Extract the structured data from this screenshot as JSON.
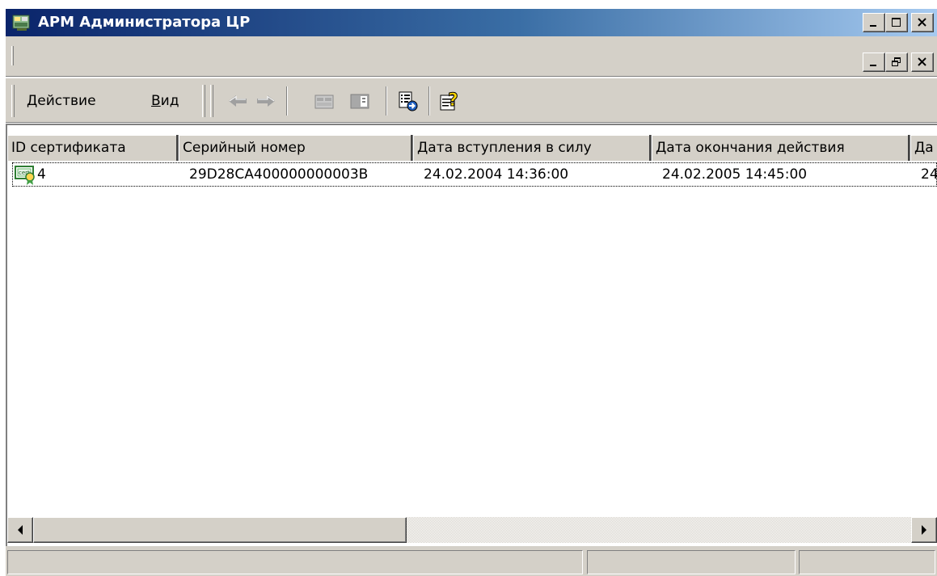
{
  "window": {
    "title": "АРМ Администратора ЦР",
    "app_icon": "mmc-console-icon",
    "caption_buttons": [
      "minimize",
      "maximize",
      "close"
    ]
  },
  "mdi_child": {
    "caption_buttons": [
      "minimize",
      "restore",
      "close"
    ]
  },
  "menu": {
    "items": [
      {
        "label_first": "Д",
        "label_rest": "ействие"
      },
      {
        "label_first": "В",
        "label_rest": "ид"
      }
    ]
  },
  "toolbar": {
    "buttons": [
      "back-arrow-icon",
      "forward-arrow-icon",
      "up-level-icon",
      "show-hide-tree-icon",
      "export-list-icon",
      "help-icon"
    ]
  },
  "table": {
    "columns": [
      "ID сертификата",
      "Серийный номер",
      "Дата вступления в силу",
      "Дата окончания действия",
      "Да"
    ],
    "rows": [
      {
        "icon": "certificate-icon",
        "cells": [
          "4",
          "29D28CA400000000003B",
          "24.02.2004 14:36:00",
          "24.02.2005 14:45:00",
          "24"
        ]
      }
    ]
  },
  "colors": {
    "title_gradient_start": "#0a246a",
    "title_gradient_end": "#a6caf0",
    "chrome": "#d4d0c8"
  }
}
